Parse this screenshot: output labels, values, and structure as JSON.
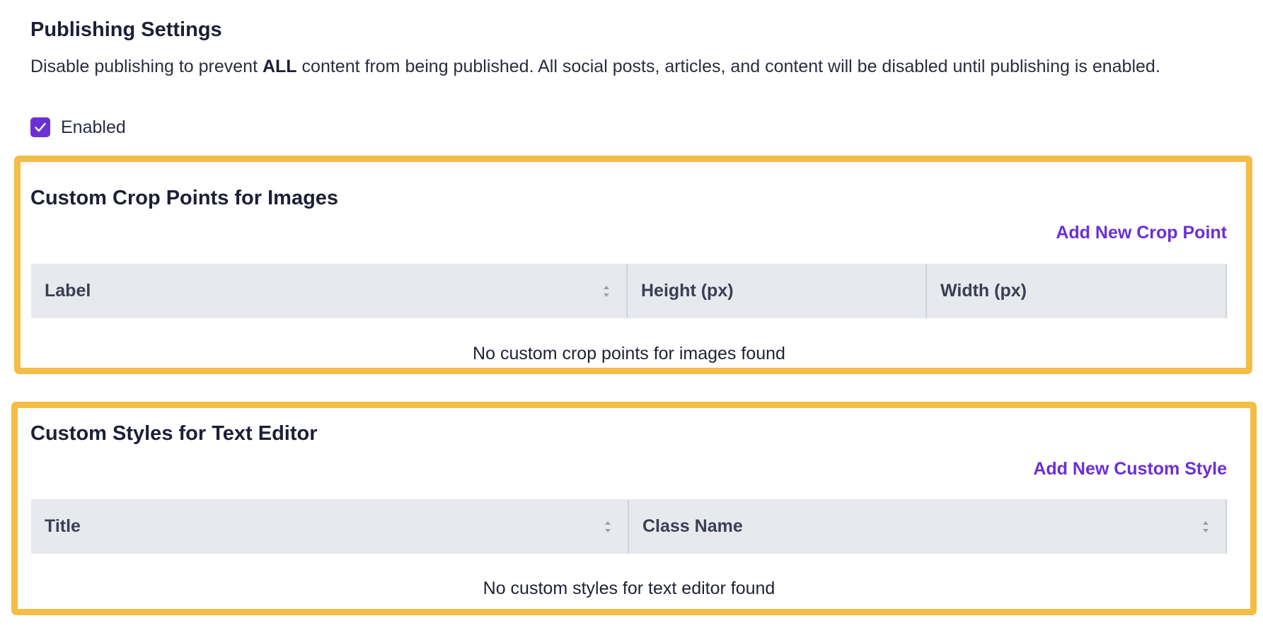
{
  "publishing": {
    "title": "Publishing Settings",
    "desc_prefix": "Disable publishing to prevent ",
    "desc_bold": "ALL",
    "desc_suffix": " content from being published. All social posts, articles, and content will be disabled until publishing is enabled.",
    "checkbox_label": "Enabled",
    "checkbox_checked": true
  },
  "crop_points": {
    "title": "Custom Crop Points for Images",
    "add_label": "Add New Crop Point",
    "columns": [
      "Label",
      "Height (px)",
      "Width (px)"
    ],
    "empty_message": "No custom crop points for images found"
  },
  "custom_styles": {
    "title": "Custom Styles for Text Editor",
    "add_label": "Add New Custom Style",
    "columns": [
      "Title",
      "Class Name"
    ],
    "empty_message": "No custom styles for text editor found"
  },
  "colors": {
    "accent": "#6b2fd6",
    "highlight": "#f3bd46",
    "table_header_bg": "#e7e9ef"
  },
  "icons": {
    "checkbox": "checkmark-icon",
    "sort": "sort-arrows-icon"
  }
}
